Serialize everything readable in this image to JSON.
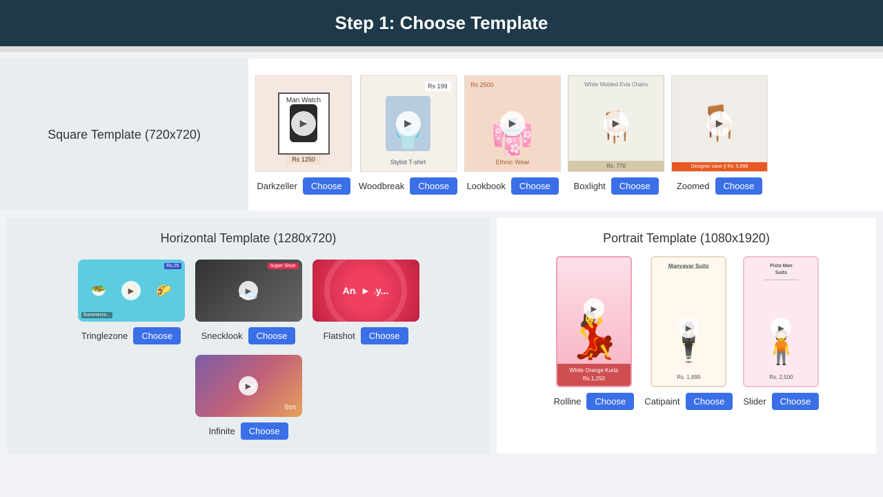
{
  "header": {
    "title": "Step 1: Choose Template"
  },
  "squareSection": {
    "label": "Square Template (720x720)",
    "templates": [
      {
        "id": "darkzeller",
        "name": "Darkzeller",
        "bg": "darkzeller",
        "priceTop": null,
        "priceBottom": "Rs 1250"
      },
      {
        "id": "woodbreak",
        "name": "Woodbreak",
        "bg": "woodbreak",
        "priceTop": "Rs 199",
        "priceBottom": "Stylist T-shirt"
      },
      {
        "id": "lookbook",
        "name": "Lookbook",
        "bg": "lookbook",
        "priceTop": "Rs 2500",
        "priceBottom": "Ethnic Wear"
      },
      {
        "id": "boxlight",
        "name": "Boxlight",
        "bg": "boxlight",
        "priceTop": "White Molded Evia Chairs",
        "priceBottom": "Rs. 770"
      },
      {
        "id": "zoomed",
        "name": "Zoomed",
        "bg": "zoomed",
        "priceTop": null,
        "priceBottom": "Designer cane || Rs. 5,999"
      }
    ],
    "chooseLabel": "Choose"
  },
  "horizontalSection": {
    "label": "Horizontal Template (1280x720)",
    "templates": [
      {
        "id": "tringlezone",
        "name": "Tringlezone",
        "bg": "tringlezone"
      },
      {
        "id": "snecklook",
        "name": "Snecklook",
        "bg": "snecklook"
      },
      {
        "id": "flatshot",
        "name": "Flatshot",
        "bg": "flatshot"
      },
      {
        "id": "infinite",
        "name": "Infinite",
        "bg": "infinite"
      }
    ],
    "chooseLabel": "Choose"
  },
  "portraitSection": {
    "label": "Portrait Template (1080x1920)",
    "templates": [
      {
        "id": "rolline",
        "name": "Rolline",
        "bg": "rolline",
        "titleTop": null,
        "priceBottom": "White Orange Kurta\nRs.1,250"
      },
      {
        "id": "catipaint",
        "name": "Catipaint",
        "bg": "catipaint",
        "titleTop": "Manyavar Suits",
        "priceBottom": "Rs. 1,899"
      },
      {
        "id": "slider",
        "name": "Slider",
        "bg": "slider",
        "titleTop": "Pista Man Suits",
        "priceBottom": "Rs. 2,500"
      }
    ],
    "chooseLabel": "Choose"
  }
}
